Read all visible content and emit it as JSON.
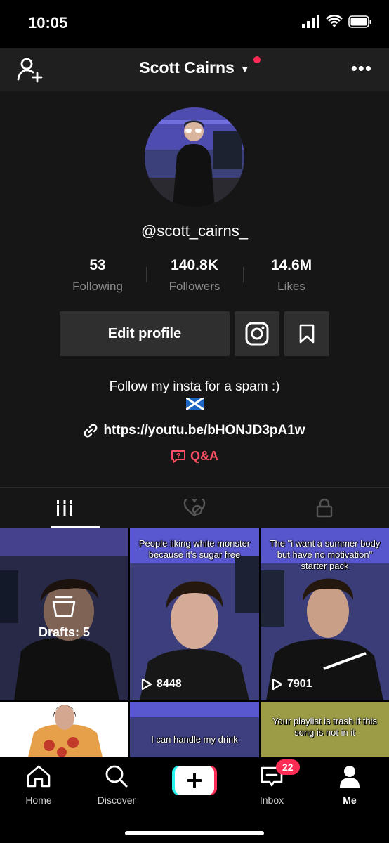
{
  "status_bar": {
    "time": "10:05"
  },
  "header": {
    "title": "Scott Cairns",
    "caret": "▼"
  },
  "profile": {
    "username": "@scott_cairns_",
    "stats": [
      {
        "value": "53",
        "label": "Following"
      },
      {
        "value": "140.8K",
        "label": "Followers"
      },
      {
        "value": "14.6M",
        "label": "Likes"
      }
    ],
    "edit_button": "Edit profile",
    "bio": "Follow my insta for a spam :)",
    "link": "https://youtu.be/bHONJD3pA1w",
    "qa": "Q&A"
  },
  "videos": [
    {
      "type": "drafts",
      "label": "Drafts: 5"
    },
    {
      "caption": "People liking white monster because it's sugar free",
      "views": "8448"
    },
    {
      "caption": "The \"i want a summer body but have no motivation\" starter pack",
      "views": "7901"
    },
    {
      "caption": "",
      "views": ""
    },
    {
      "caption": "I can handle my drink",
      "views": ""
    },
    {
      "caption": "Your playlist is trash if this song is not in it",
      "views": ""
    }
  ],
  "nav": {
    "home": "Home",
    "discover": "Discover",
    "inbox": "Inbox",
    "inbox_badge": "22",
    "me": "Me"
  },
  "colors": {
    "accent": "#fe2c55",
    "qa": "#fe4d64",
    "background": "#161616"
  }
}
